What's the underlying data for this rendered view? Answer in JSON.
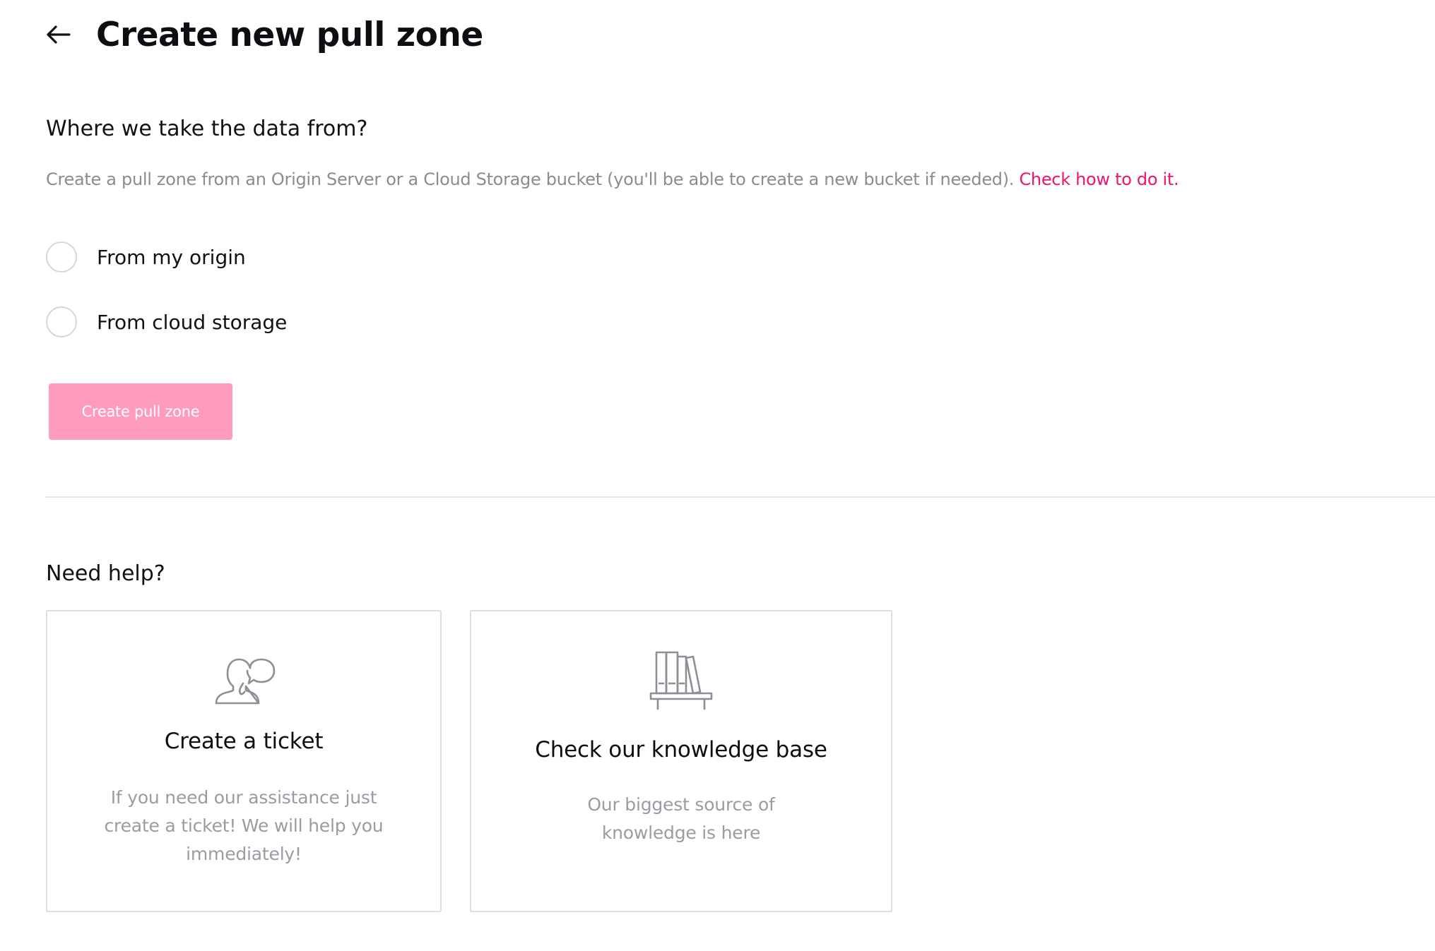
{
  "header": {
    "back_icon": "arrow-left-icon",
    "title": "Create new pull zone"
  },
  "source_section": {
    "heading": "Where we take the data from?",
    "description": "Create a pull zone from an Origin Server or a Cloud Storage bucket (you'll be able to create a new bucket if needed).",
    "link_text": "Check how to do it.",
    "options": [
      {
        "label": "From my origin",
        "selected": false
      },
      {
        "label": "From cloud storage",
        "selected": false
      }
    ],
    "submit_label": "Create pull zone"
  },
  "help_section": {
    "heading": "Need help?",
    "cards": [
      {
        "icon": "support-chat-icon",
        "title": "Create a ticket",
        "text": "If you need our assistance just create a ticket! We will help you immediately!"
      },
      {
        "icon": "bookshelf-icon",
        "title": "Check our knowledge base",
        "text": "Our biggest source of knowledge is here"
      }
    ]
  },
  "colors": {
    "accent": "#f0146c",
    "button_disabled": "#ff9bbf",
    "muted_text": "#8b8b93"
  }
}
